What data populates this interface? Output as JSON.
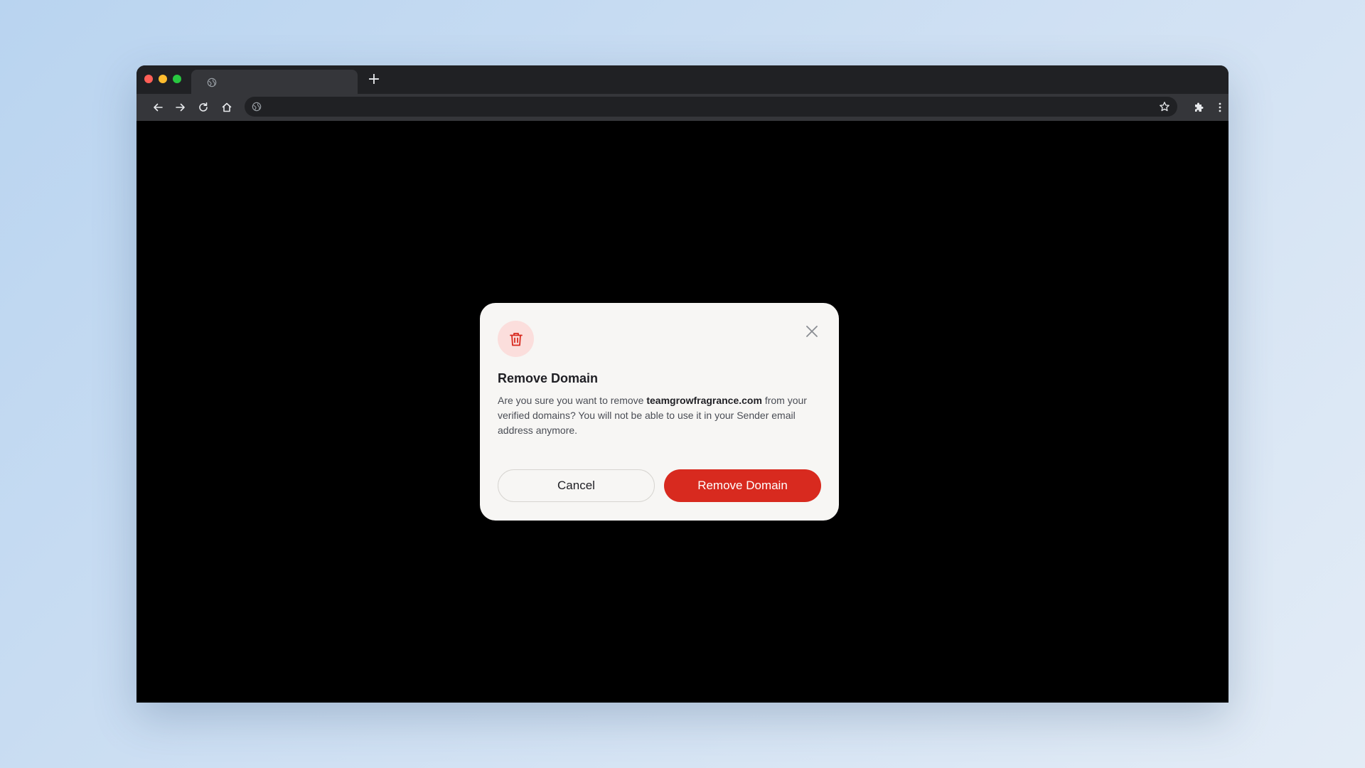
{
  "browser": {
    "tab_title": "",
    "address": "",
    "icons": {
      "back": "arrow-left-icon",
      "forward": "arrow-right-icon",
      "reload": "reload-icon",
      "home": "home-icon",
      "bookmark": "star-icon",
      "extensions": "puzzle-icon",
      "menu": "kebab-menu-icon"
    }
  },
  "dialog": {
    "title": "Remove Domain",
    "body_prefix": "Are you sure you want to remove ",
    "domain": "teamgrowfragrance.com",
    "body_suffix": " from your verified domains? You will not be able to use it in your Sender email address anymore.",
    "cancel_label": "Cancel",
    "confirm_label": "Remove Domain",
    "icon": "trash-icon",
    "close_icon": "close-icon"
  },
  "colors": {
    "danger": "#d82a1f",
    "danger_soft": "#fbdedc",
    "dialog_bg": "#f7f6f4"
  }
}
